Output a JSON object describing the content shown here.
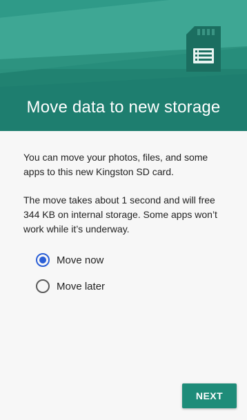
{
  "header": {
    "title": "Move data to new storage",
    "color": "#1e7e6f",
    "icon": "sd-card-icon"
  },
  "body": {
    "paragraph1": "You can move your photos, files, and some apps to this new Kingston SD card.",
    "paragraph2": "The move takes about 1 second and will free 344 KB on internal storage. Some apps won’t work while it’s underway."
  },
  "options": [
    {
      "label": "Move now",
      "selected": true
    },
    {
      "label": "Move later",
      "selected": false
    }
  ],
  "footer": {
    "next_label": "NEXT",
    "accent": "#1e8c79"
  },
  "colors": {
    "radio_selected": "#2b5fd6"
  }
}
